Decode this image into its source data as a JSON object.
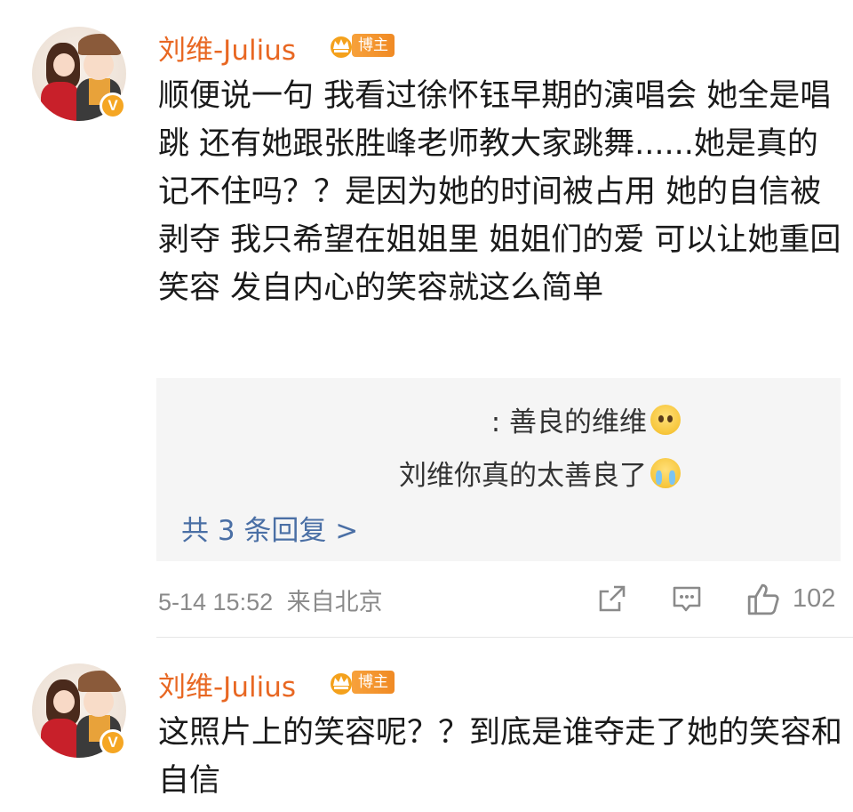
{
  "comments": [
    {
      "username": "刘维-Julius",
      "badge": "博主",
      "avatar_icon": "cartoon-couple-avatar",
      "verified_icon": "yellow-v-badge",
      "verified_mark": "V",
      "text": "顺便说一句 我看过徐怀钰早期的演唱会 她全是唱跳 还有她跟张胜峰老师教大家跳舞......她是真的记不住吗？？是因为她的时间被占用 她的自信被剥夺 我只希望在姐姐里 姐姐们的爱 可以让她重回笑容 发自内心的笑容就这么简单",
      "replies": [
        {
          "text": ": 善良的维维",
          "emoji": "pleading-face-emoji"
        },
        {
          "text": "刘维你真的太善良了",
          "emoji": "crying-face-emoji"
        }
      ],
      "reply_count_label": "共 3 条回复 >",
      "timestamp": "5-14 15:52",
      "source": "来自北京",
      "like_count": "102"
    },
    {
      "username": "刘维-Julius",
      "badge": "博主",
      "avatar_icon": "cartoon-couple-avatar",
      "verified_icon": "yellow-v-badge",
      "verified_mark": "V",
      "text": "这照片上的笑容呢？？到底是谁夺走了她的笑容和自信"
    }
  ],
  "colors": {
    "username": "#e86722",
    "link": "#4a6fa5",
    "meta": "#8a8a8a",
    "reply_bg": "#f5f5f5",
    "badge": "#f08a24"
  }
}
